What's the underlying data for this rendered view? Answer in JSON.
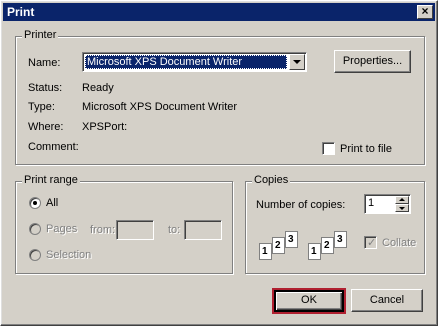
{
  "window": {
    "title": "Print",
    "close_glyph": "×"
  },
  "printer": {
    "group_label": "Printer",
    "name_label": "Name:",
    "name_value": "Microsoft XPS Document Writer",
    "properties_button": "Properties...",
    "status_label": "Status:",
    "status_value": "Ready",
    "type_label": "Type:",
    "type_value": "Microsoft XPS Document Writer",
    "where_label": "Where:",
    "where_value": "XPSPort:",
    "comment_label": "Comment:",
    "comment_value": "",
    "print_to_file_label": "Print to file"
  },
  "print_range": {
    "group_label": "Print range",
    "all_label": "All",
    "pages_label": "Pages",
    "from_label": "from:",
    "to_label": "to:",
    "from_value": "",
    "to_value": "",
    "selection_label": "Selection"
  },
  "copies": {
    "group_label": "Copies",
    "number_label": "Number of copies:",
    "number_value": "1",
    "collate_label": "Collate",
    "page_numbers": [
      "1",
      "2",
      "3"
    ]
  },
  "buttons": {
    "ok": "OK",
    "cancel": "Cancel"
  },
  "colors": {
    "title_bar": "#0a246a",
    "dialog_bg": "#d4d0c8",
    "ok_focus_frame": "#b02030"
  }
}
